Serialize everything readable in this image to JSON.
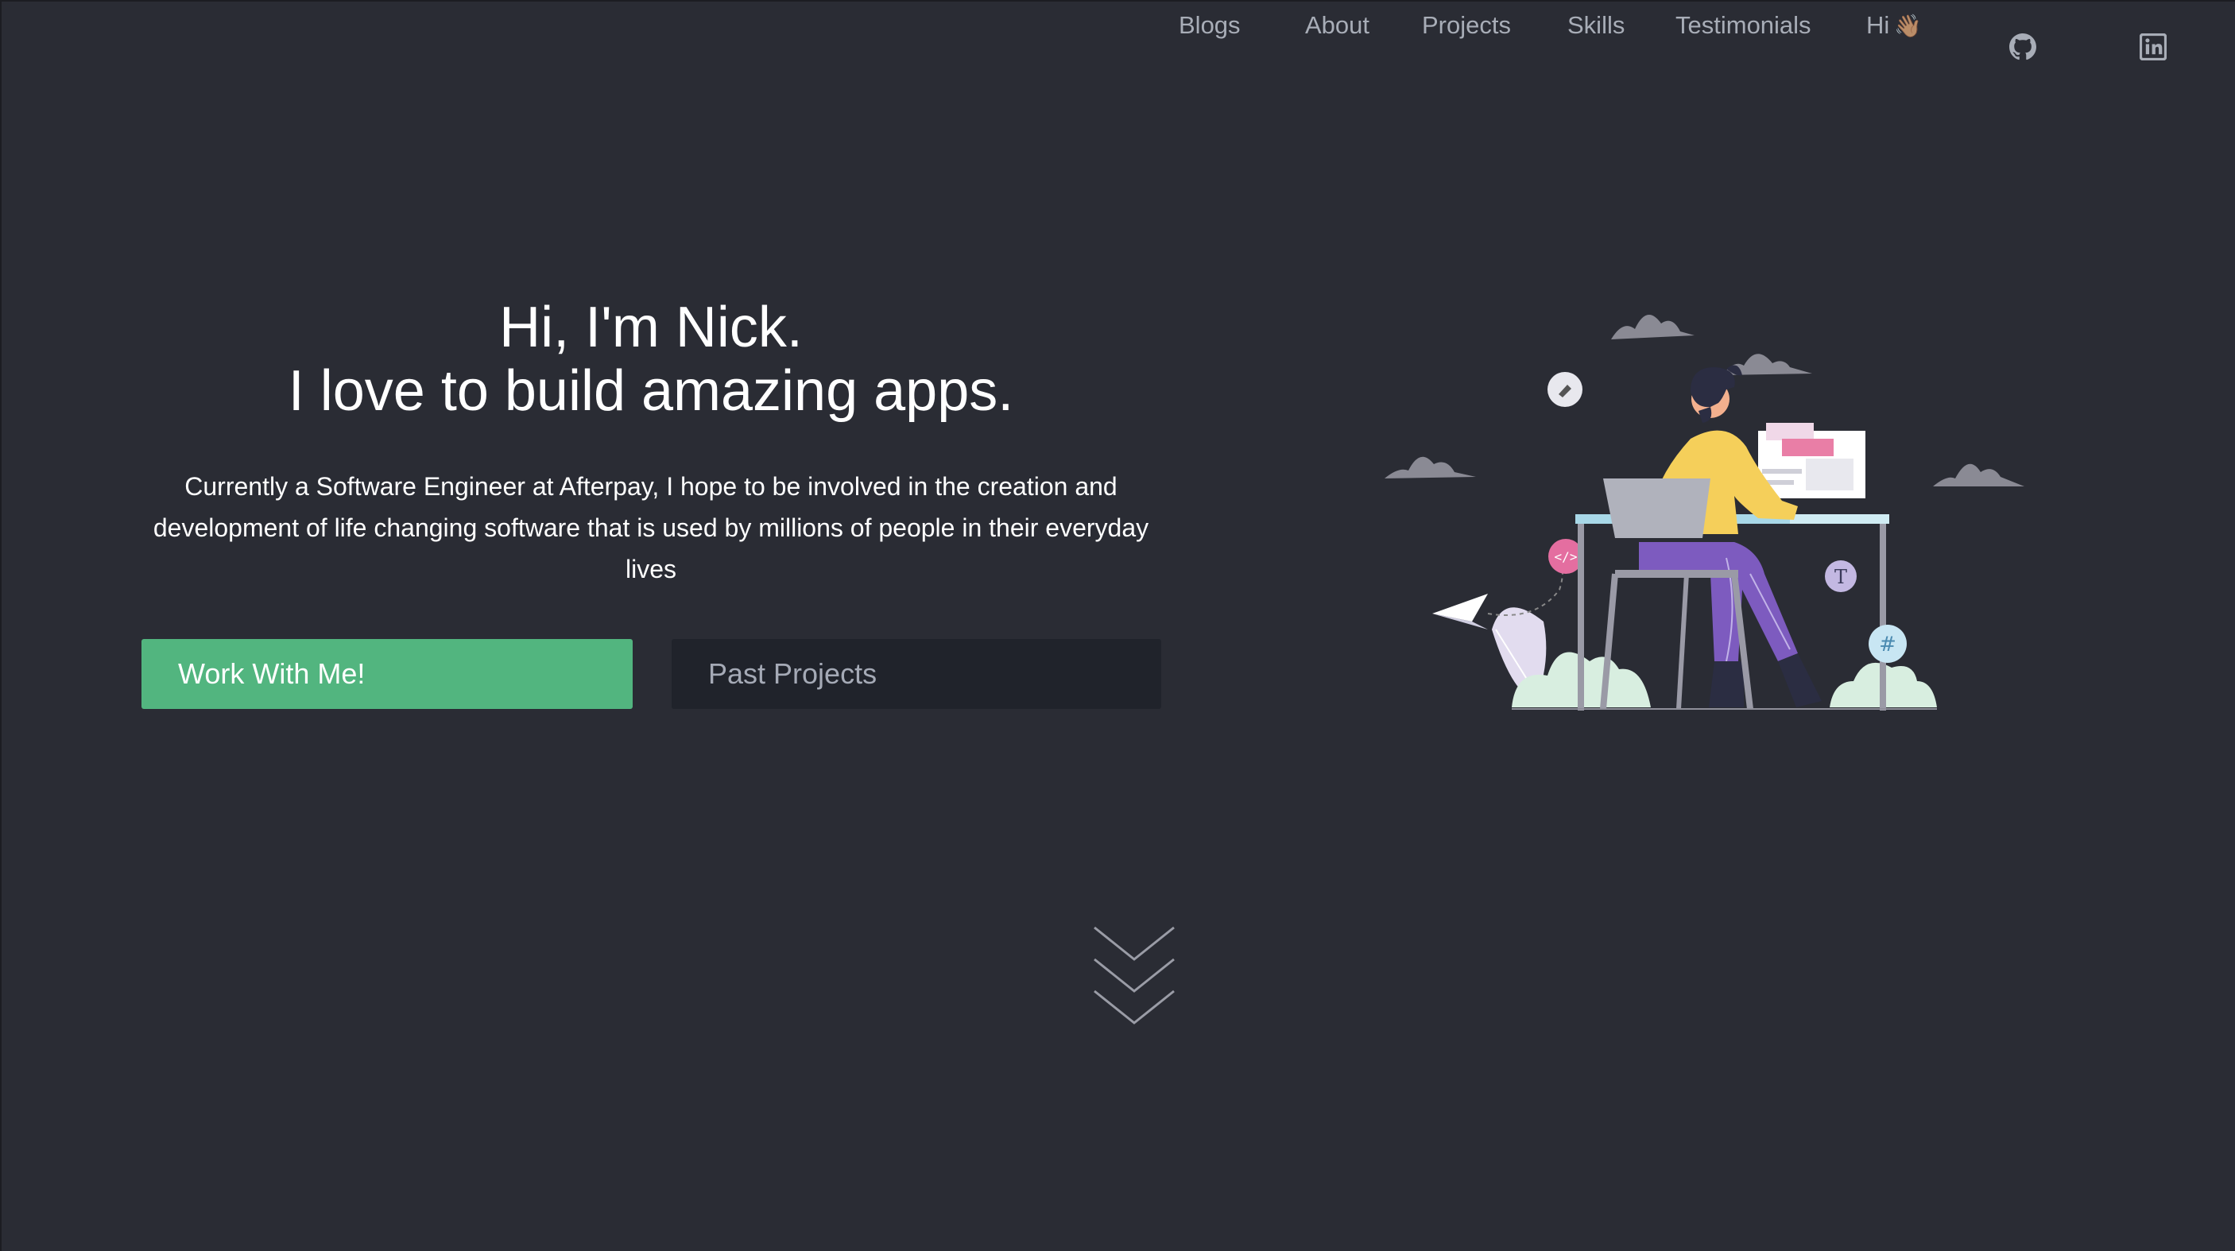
{
  "nav": {
    "links": [
      "Blogs",
      "About",
      "Projects",
      "Skills",
      "Testimonials"
    ],
    "hi_label": "Hi",
    "hi_emoji": "👋🏽",
    "icons": [
      "github-icon",
      "linkedin-icon"
    ]
  },
  "hero": {
    "title_line1": "Hi, I'm Nick.",
    "title_line2": "I love to build amazing apps.",
    "description": "Currently a Software Engineer at Afterpay, I hope to be involved in the creation and development of life changing software that is used by millions of people in their everyday lives",
    "primary_button": "Work With Me!",
    "secondary_button": "Past Projects"
  },
  "colors": {
    "background": "#2a2c34",
    "primary_button": "#52b57f",
    "secondary_button": "#20232b",
    "nav_text": "#a8adb7"
  },
  "icons": {
    "scroll": "chevron-down-icon"
  }
}
